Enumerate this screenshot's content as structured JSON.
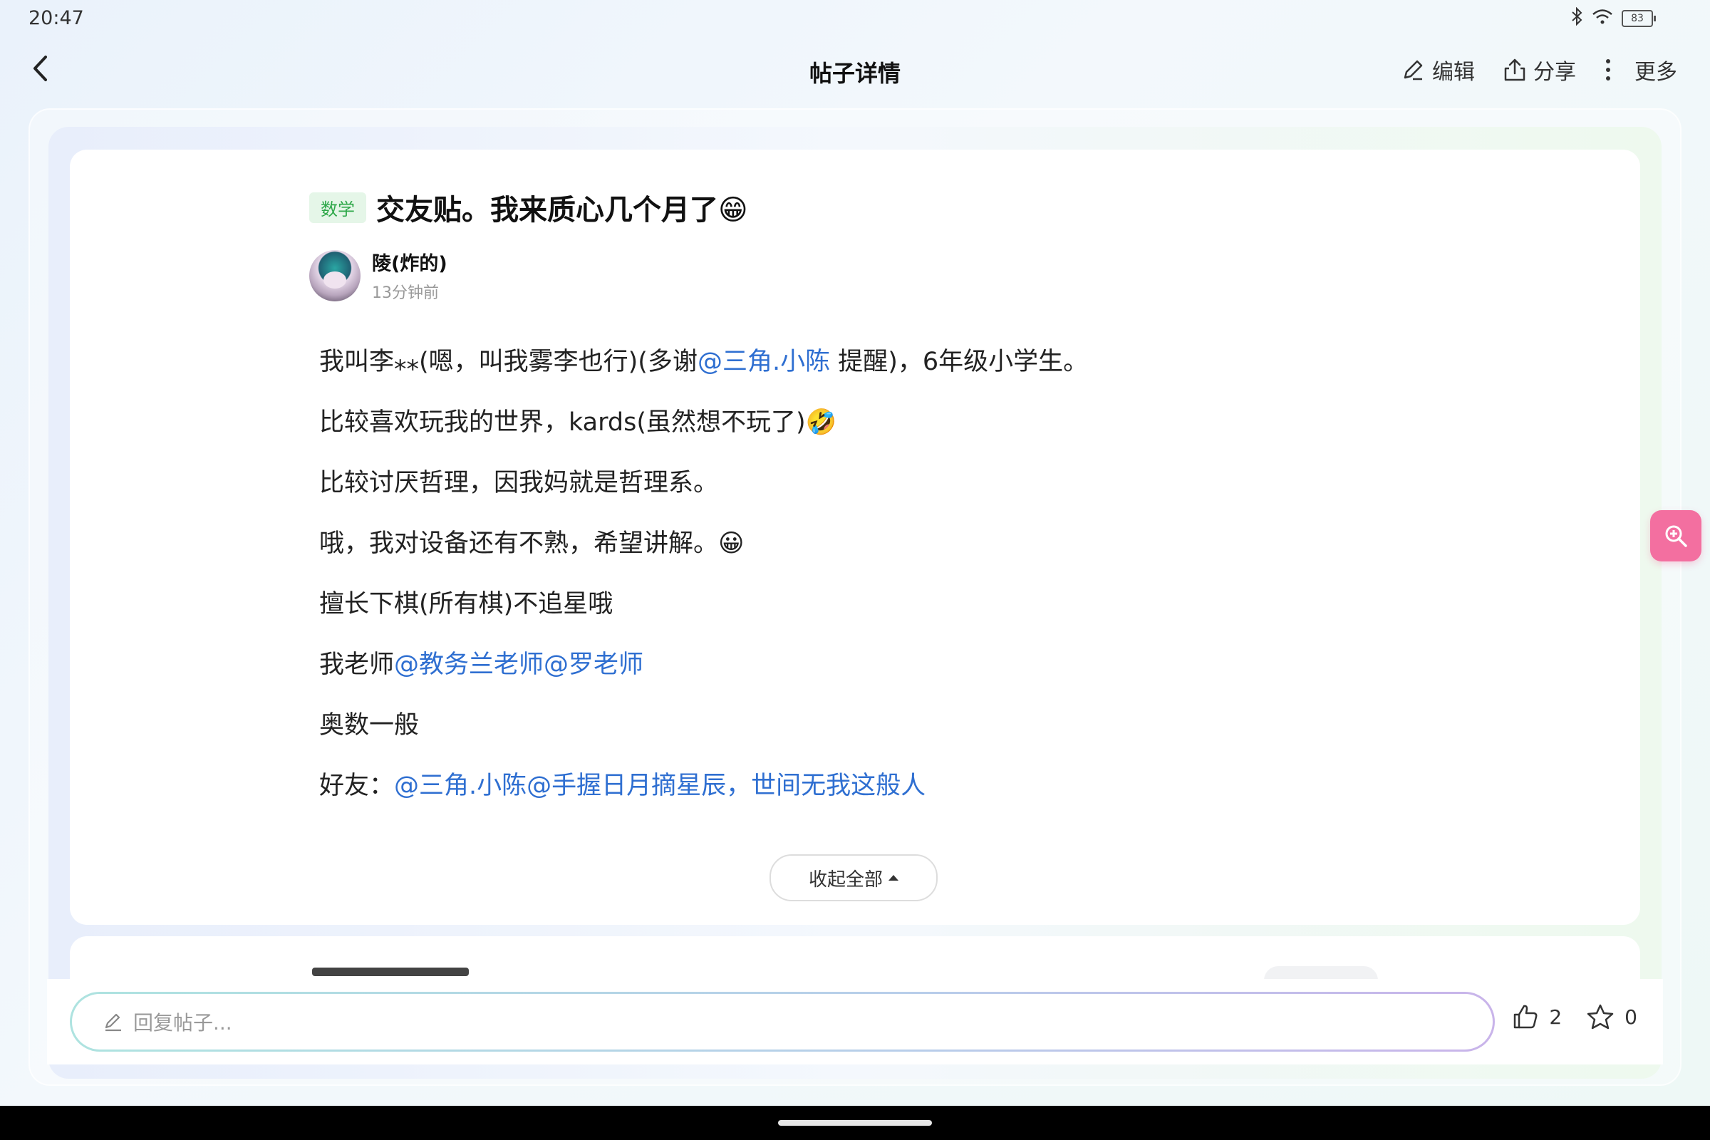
{
  "status_bar": {
    "time": "20:47",
    "battery": "83"
  },
  "nav": {
    "title": "帖子详情",
    "actions": [
      {
        "label": "编辑",
        "icon": "edit-icon"
      },
      {
        "label": "分享",
        "icon": "share-icon"
      },
      {
        "label": "更多",
        "icon": "more-icon"
      }
    ]
  },
  "post": {
    "subject_tag": "数学",
    "title": "交友贴。我来质心几个月了😁",
    "author": "陵(炸的)",
    "time": "13分钟前",
    "body": [
      {
        "parts": [
          {
            "t": "我叫李⁎⁎(嗯，叫我雾李也行)(多谢",
            "m": false
          },
          {
            "t": "@三角.小陈",
            "m": true
          },
          {
            "t": " 提醒)，6年级小学生。",
            "m": false
          }
        ]
      },
      {
        "parts": [
          {
            "t": "比较喜欢玩我的世界，kards(虽然想不玩了)🤣",
            "m": false
          }
        ]
      },
      {
        "parts": [
          {
            "t": "比较讨厌哲理，因我妈就是哲理系。",
            "m": false
          }
        ]
      },
      {
        "parts": [
          {
            "t": "哦，我对设备还有不熟，希望讲解。😀",
            "m": false
          }
        ]
      },
      {
        "parts": [
          {
            "t": "擅长下棋(所有棋)不追星哦",
            "m": false
          }
        ]
      },
      {
        "parts": [
          {
            "t": "我老师",
            "m": false
          },
          {
            "t": "@教务兰老师",
            "m": true
          },
          {
            "t": "@罗老师",
            "m": true
          }
        ]
      },
      {
        "parts": [
          {
            "t": "奥数一般",
            "m": false
          }
        ]
      },
      {
        "parts": [
          {
            "t": "好友：",
            "m": false
          },
          {
            "t": "@三角.小陈",
            "m": true
          },
          {
            "t": "@手握日月摘星辰，世间无我这般人",
            "m": true
          }
        ]
      }
    ],
    "collapse_label": "收起全部"
  },
  "reply": {
    "placeholder": "回复帖子...",
    "like_count": "2",
    "favorite_count": "0"
  },
  "colors": {
    "mention": "#2f6fd1",
    "tag_bg": "#e5f6e8",
    "tag_text": "#2fa84a",
    "zoom_button": "#f36fa0"
  }
}
